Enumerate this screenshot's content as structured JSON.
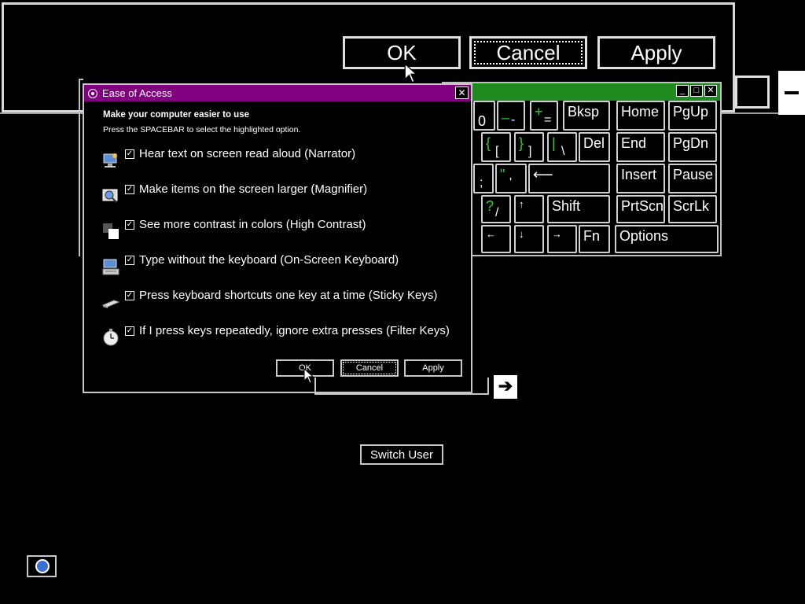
{
  "background_panel": {
    "ok": "OK",
    "cancel": "Cancel",
    "apply": "Apply"
  },
  "osk": {
    "keys": {
      "zero": "0",
      "minus_top": "_",
      "minus_bot": "-",
      "plus_top": "+",
      "plus_bot": "=",
      "bksp": "Bksp",
      "home": "Home",
      "pgup": "PgUp",
      "lbrace": "{",
      "lbracket": "[",
      "rbrace": "}",
      "rbracket": "]",
      "pipe": "|",
      "backslash": "\\",
      "del": "Del",
      "end": "End",
      "pgdn": "PgDn",
      "semicolon": ";",
      "quote_top": "\"",
      "quote_bot": "'",
      "enter": "⟵",
      "insert": "Insert",
      "pause": "Pause",
      "question": "?",
      "slash": "/",
      "up": "↑",
      "shift": "Shift",
      "prtscn": "PrtScn",
      "scrlk": "ScrLk",
      "left": "←",
      "down": "↓",
      "right": "→",
      "fn": "Fn",
      "options": "Options"
    }
  },
  "dialog": {
    "title": "Ease of Access",
    "close": "✕",
    "heading": "Make your computer easier to use",
    "subheading": "Press the SPACEBAR to select the highlighted option.",
    "options": [
      {
        "label": "Hear text on screen read aloud (Narrator)",
        "checked": true,
        "icon": "narrator-icon"
      },
      {
        "label": "Make items on the screen larger (Magnifier)",
        "checked": true,
        "icon": "magnifier-icon"
      },
      {
        "label": "See more contrast in colors (High Contrast)",
        "checked": true,
        "icon": "high-contrast-icon"
      },
      {
        "label": "Type without the keyboard (On-Screen Keyboard)",
        "checked": true,
        "icon": "keyboard-icon"
      },
      {
        "label": "Press keyboard shortcuts one key at a time (Sticky Keys)",
        "checked": true,
        "icon": "sticky-keys-icon"
      },
      {
        "label": "If I press keys repeatedly, ignore extra presses (Filter Keys)",
        "checked": true,
        "icon": "filter-keys-icon"
      }
    ],
    "check_mark": "✓",
    "ok": "OK",
    "cancel": "Cancel",
    "apply": "Apply"
  },
  "logon": {
    "switch_user": "Switch User",
    "go_arrow": "➔"
  }
}
